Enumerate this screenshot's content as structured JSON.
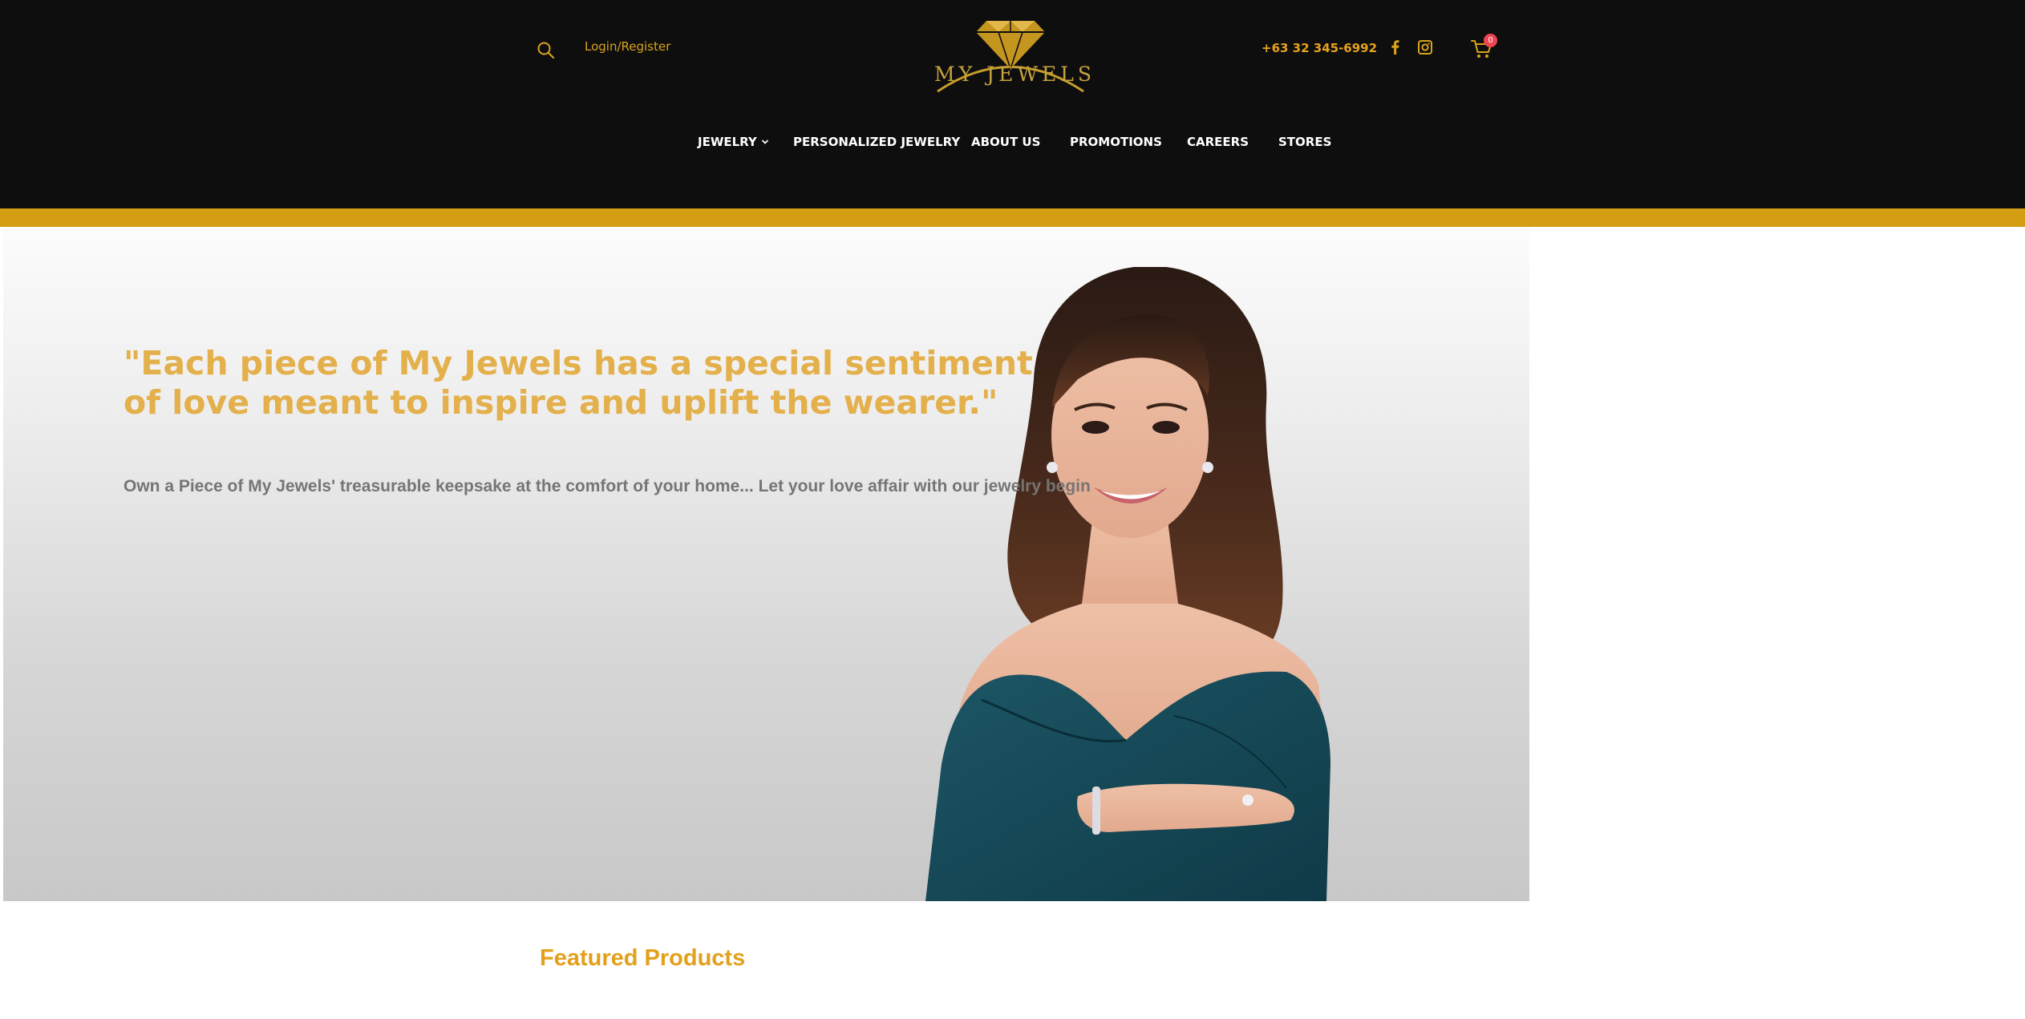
{
  "header": {
    "login_label": "Login/Register",
    "phone": "+63 32 345-6992",
    "logo_text": "MY JEWELS",
    "cart_count": "0",
    "icons": [
      "search-icon",
      "facebook-icon",
      "instagram-icon",
      "cart-icon"
    ]
  },
  "nav": {
    "items": [
      {
        "label": "JEWELRY",
        "has_dropdown": true
      },
      {
        "label": "PERSONALIZED JEWELRY"
      },
      {
        "label": "ABOUT US"
      },
      {
        "label": "PROMOTIONS"
      },
      {
        "label": "CAREERS"
      },
      {
        "label": "STORES"
      }
    ]
  },
  "hero": {
    "quote": "\"Each piece of My Jewels has a special sentiment of love meant to inspire and uplift the wearer.\"",
    "subtitle": "Own a Piece of My Jewels' treasurable keepsake at the comfort of your home... Let your love affair with our jewelry begin"
  },
  "featured": {
    "title": "Featured Products"
  },
  "colors": {
    "header_bg": "#0e0e0e",
    "gold": "#d49e13",
    "accent": "#e3a01b",
    "quote": "#e3b04b",
    "badge": "#ee4553"
  }
}
